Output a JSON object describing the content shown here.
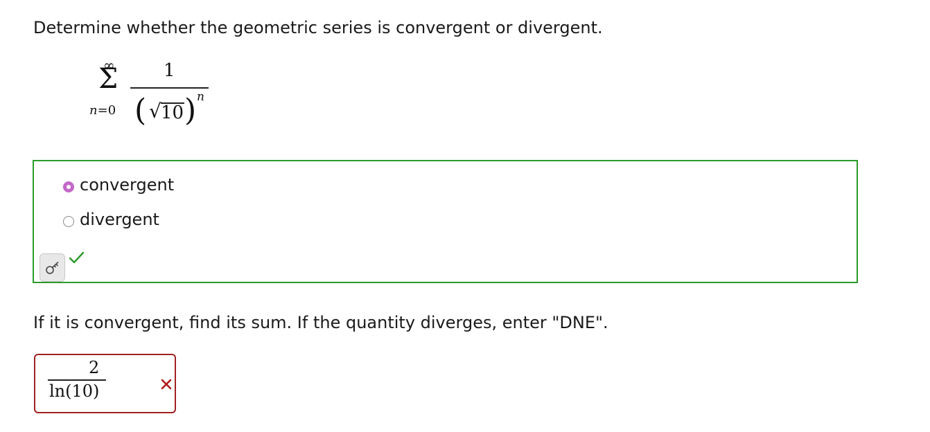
{
  "question1": {
    "prompt": "Determine whether the geometric series is convergent or divergent."
  },
  "series": {
    "upper_limit": "∞",
    "sigma": "Σ",
    "lower_index": "n",
    "lower_eq": "=",
    "lower_value": "0",
    "numerator": "1",
    "left_paren": "(",
    "right_paren": ")",
    "radical": "√",
    "radicand": "10",
    "exponent": "n"
  },
  "options": [
    {
      "label": "convergent",
      "selected": true
    },
    {
      "label": "divergent",
      "selected": false
    }
  ],
  "feedback": {
    "status": "correct",
    "accent_color": "#2a9a2a",
    "selected_color": "#c468c8",
    "icons": [
      "key-icon",
      "checkmark-icon"
    ]
  },
  "question2": {
    "prompt": "If it is convergent, find its sum. If the quantity diverges, enter \"DNE\"."
  },
  "response": {
    "numerator": "2",
    "denominator": "ln(10)",
    "status": "incorrect",
    "accent_color": "#a02020",
    "icon": "cross-icon"
  }
}
